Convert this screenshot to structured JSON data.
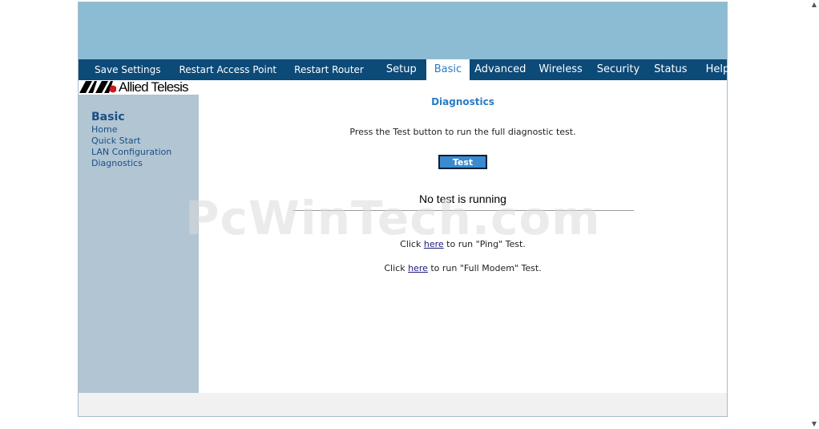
{
  "nav": {
    "items": [
      {
        "label": "Save Settings",
        "active": false
      },
      {
        "label": "Restart Access Point",
        "active": false
      },
      {
        "label": "Restart Router",
        "active": false
      },
      {
        "label": "Setup",
        "active": false
      },
      {
        "label": "Basic",
        "active": true
      },
      {
        "label": "Advanced",
        "active": false
      },
      {
        "label": "Wireless",
        "active": false
      },
      {
        "label": "Security",
        "active": false
      },
      {
        "label": "Status",
        "active": false
      },
      {
        "label": "Help",
        "active": false
      }
    ]
  },
  "logo": {
    "text": "Allied Telesis"
  },
  "sidebar": {
    "title": "Basic",
    "items": [
      {
        "label": "Home"
      },
      {
        "label": "Quick Start"
      },
      {
        "label": "LAN Configuration"
      },
      {
        "label": "Diagnostics"
      }
    ]
  },
  "main": {
    "title": "Diagnostics",
    "instructions": "Press the Test button to run the full diagnostic test.",
    "test_button_label": "Test",
    "status": "No test is running",
    "ping": {
      "before": "Click ",
      "link": "here",
      "after": " to run \"Ping\" Test."
    },
    "modem": {
      "before": "Click ",
      "link": "here",
      "after": " to run \"Full Modem\" Test."
    }
  },
  "watermark": "PcWinTech.com",
  "colors": {
    "banner": "#8cbcd4",
    "navbar": "#0c4a78",
    "sidebar": "#b1c5d3",
    "accent": "#2a7bc4"
  }
}
